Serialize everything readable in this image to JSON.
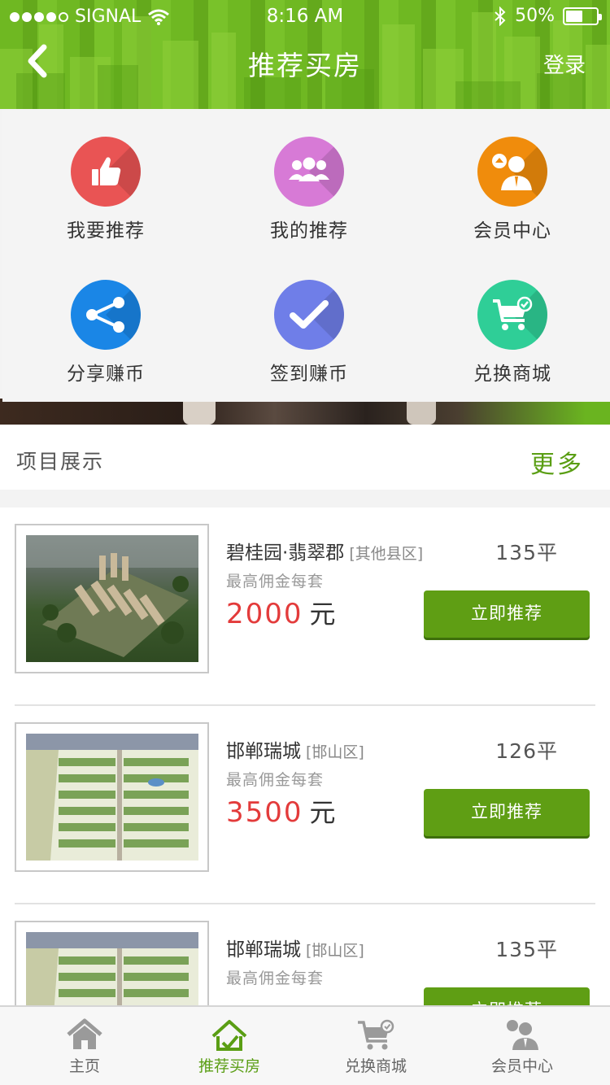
{
  "status_bar": {
    "carrier": "SIGNAL",
    "time": "8:16 AM",
    "battery": "50%"
  },
  "nav": {
    "title": "推荐买房",
    "login_label": "登录"
  },
  "grid": {
    "items": [
      {
        "label": "我要推荐",
        "icon": "thumbs-up-icon",
        "color": "#e95454"
      },
      {
        "label": "我的推荐",
        "icon": "group-icon",
        "color": "#d77ad6"
      },
      {
        "label": "会员中心",
        "icon": "member-icon",
        "color": "#f08c0c"
      },
      {
        "label": "分享赚币",
        "icon": "share-icon",
        "color": "#1a86e6"
      },
      {
        "label": "签到赚币",
        "icon": "checkmark-icon",
        "color": "#6f7ee8"
      },
      {
        "label": "兑换商城",
        "icon": "cart-icon",
        "color": "#2fce97"
      }
    ]
  },
  "section": {
    "title": "项目展示",
    "more_label": "更多"
  },
  "projects": [
    {
      "name": "碧桂园·翡翠郡",
      "area": "[其他县区]",
      "sqm": "135平",
      "sub": "最高佣金每套",
      "price": "2000",
      "unit": "元",
      "button": "立即推荐"
    },
    {
      "name": "邯郸瑞城",
      "area": "[邯山区]",
      "sqm": "126平",
      "sub": "最高佣金每套",
      "price": "3500",
      "unit": "元",
      "button": "立即推荐"
    },
    {
      "name": "邯郸瑞城",
      "area": "[邯山区]",
      "sqm": "135平",
      "sub": "最高佣金每套",
      "price": "",
      "unit": "",
      "button": "立即推荐"
    }
  ],
  "tabbar": {
    "items": [
      {
        "label": "主页",
        "icon": "home-icon",
        "active": false
      },
      {
        "label": "推荐买房",
        "icon": "house-recommend-icon",
        "active": true
      },
      {
        "label": "兑换商城",
        "icon": "cart-icon",
        "active": false
      },
      {
        "label": "会员中心",
        "icon": "member-icon",
        "active": false
      }
    ]
  },
  "colors": {
    "brand_green": "#5f9e14",
    "price_red": "#e33b3b"
  }
}
